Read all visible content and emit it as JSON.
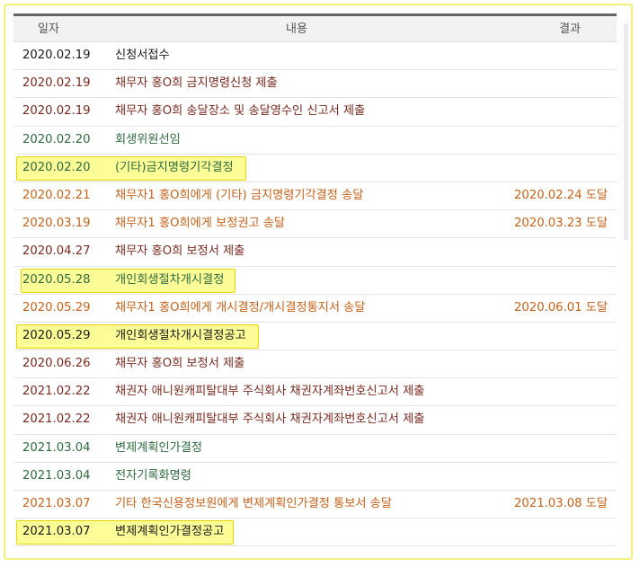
{
  "header": {
    "date": "일자",
    "content": "내용",
    "result": "결과"
  },
  "rows": [
    {
      "date": "2020.02.19",
      "content": "신청서접수",
      "result": "",
      "color": "black",
      "highlight": false
    },
    {
      "date": "2020.02.19",
      "content": "채무자 홍O희 금지명령신청 제출",
      "result": "",
      "color": "maroon",
      "highlight": false
    },
    {
      "date": "2020.02.19",
      "content": "채무자 홍O희 송달장소 및 송달영수인 신고서 제출",
      "result": "",
      "color": "maroon",
      "highlight": false
    },
    {
      "date": "2020.02.20",
      "content": "회생위원선임",
      "result": "",
      "color": "green",
      "highlight": false
    },
    {
      "date": "2020.02.20",
      "content": "(기타)금지명령기각결정",
      "result": "",
      "color": "green",
      "highlight": true
    },
    {
      "date": "2020.02.21",
      "content": "채무자1 홍O희에게 (기타) 금지명령기각결정 송달",
      "result": "2020.02.24 도달",
      "color": "orange",
      "highlight": false
    },
    {
      "date": "2020.03.19",
      "content": "채무자1 홍O희에게 보정권고 송달",
      "result": "2020.03.23 도달",
      "color": "orange",
      "highlight": false
    },
    {
      "date": "2020.04.27",
      "content": "채무자 홍O희 보정서 제출",
      "result": "",
      "color": "maroon",
      "highlight": false
    },
    {
      "date": "2020.05.28",
      "content": "개인회생절차개시결정",
      "result": "",
      "color": "green",
      "highlight": true
    },
    {
      "date": "2020.05.29",
      "content": "채무자1 홍O희에게 개시결정/개시결정통지서 송달",
      "result": "2020.06.01 도달",
      "color": "orange",
      "highlight": false
    },
    {
      "date": "2020.05.29",
      "content": "개인회생절차개시결정공고",
      "result": "",
      "color": "black",
      "highlight": true
    },
    {
      "date": "2020.06.26",
      "content": "채무자 홍O희 보정서 제출",
      "result": "",
      "color": "maroon",
      "highlight": false
    },
    {
      "date": "2021.02.22",
      "content": "채권자 애니원캐피탈대부 주식회사 채권자계좌번호신고서 제출",
      "result": "",
      "color": "maroon",
      "highlight": false
    },
    {
      "date": "2021.02.22",
      "content": "채권자 애니원캐피탈대부 주식회사 채권자계좌번호신고서 제출",
      "result": "",
      "color": "maroon",
      "highlight": false
    },
    {
      "date": "2021.03.04",
      "content": "변제계획인가결정",
      "result": "",
      "color": "green",
      "highlight": false
    },
    {
      "date": "2021.03.04",
      "content": "전자기록화명령",
      "result": "",
      "color": "green",
      "highlight": false
    },
    {
      "date": "2021.03.07",
      "content": "기타 한국신용정보원에게 변제계획인가결정 통보서 송달",
      "result": "2021.03.08 도달",
      "color": "orange",
      "highlight": false
    },
    {
      "date": "2021.03.07",
      "content": "변제계획인가결정공고",
      "result": "",
      "color": "black",
      "highlight": true
    }
  ],
  "colors": {
    "black": "#1a1a1a",
    "maroon": "#7a2a1f",
    "green": "#2f6b3f",
    "orange": "#c5621b",
    "highlight_fill": "#fdfd98",
    "highlight_border": "#e6d400",
    "frame_border": "#f4f07a"
  }
}
